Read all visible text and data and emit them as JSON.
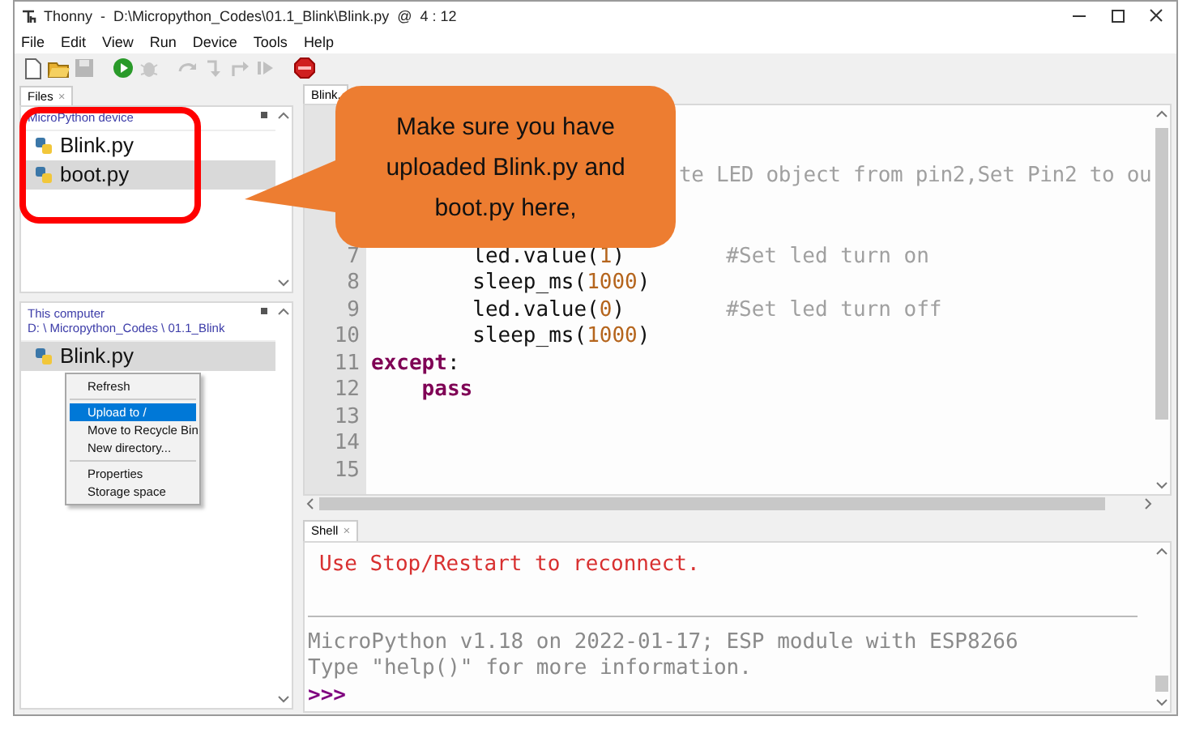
{
  "window": {
    "title": "Thonny  -  D:\\Micropython_Codes\\01.1_Blink\\Blink.py  @  4 : 12"
  },
  "menu": [
    "File",
    "Edit",
    "View",
    "Run",
    "Device",
    "Tools",
    "Help"
  ],
  "toolbar": [
    {
      "kind": "new",
      "disabled": false
    },
    {
      "kind": "open",
      "disabled": false
    },
    {
      "kind": "save",
      "disabled": true
    },
    {
      "kind": "run",
      "disabled": false
    },
    {
      "kind": "debug",
      "disabled": true
    },
    {
      "kind": "step-over",
      "disabled": true
    },
    {
      "kind": "step-into",
      "disabled": true
    },
    {
      "kind": "step-out",
      "disabled": true
    },
    {
      "kind": "resume",
      "disabled": true
    },
    {
      "kind": "stop",
      "disabled": false
    }
  ],
  "files_tab": {
    "label": "Files",
    "close": "×"
  },
  "device_panel": {
    "header": "MicroPython device",
    "files": [
      {
        "name": "Blink.py",
        "selected": false
      },
      {
        "name": "boot.py",
        "selected": true
      }
    ]
  },
  "computer_panel": {
    "header": "This computer",
    "path": "D: \\ Micropython_Codes \\ 01.1_Blink",
    "files": [
      {
        "name": "Blink.py",
        "selected": true
      }
    ]
  },
  "context_menu": [
    {
      "kind": "item",
      "label": "Refresh",
      "selected": false
    },
    {
      "kind": "separator"
    },
    {
      "kind": "item",
      "label": "Upload to /",
      "selected": true
    },
    {
      "kind": "item",
      "label": "Move to Recycle Bin",
      "selected": false
    },
    {
      "kind": "item",
      "label": "New directory...",
      "selected": false
    },
    {
      "kind": "separator"
    },
    {
      "kind": "item",
      "label": "Properties",
      "selected": false
    },
    {
      "kind": "item",
      "label": "Storage space",
      "selected": false
    }
  ],
  "editor": {
    "tab": "Blink.",
    "covered_line": {
      "tokens": [
        {
          "kind": "comment",
          "text": "te LED object from pin2,Set Pin2 to ou"
        }
      ]
    },
    "lines": [
      {
        "number": "7",
        "tokens": [
          {
            "kind": "plain",
            "text": "        led.value("
          },
          {
            "kind": "number",
            "text": "1"
          },
          {
            "kind": "plain",
            "text": ")        "
          },
          {
            "kind": "comment",
            "text": "#Set led turn on"
          }
        ]
      },
      {
        "number": "8",
        "tokens": [
          {
            "kind": "plain",
            "text": "        sleep_ms("
          },
          {
            "kind": "number",
            "text": "1000"
          },
          {
            "kind": "plain",
            "text": ")"
          }
        ]
      },
      {
        "number": "9",
        "tokens": [
          {
            "kind": "plain",
            "text": "        led.value("
          },
          {
            "kind": "number",
            "text": "0"
          },
          {
            "kind": "plain",
            "text": ")        "
          },
          {
            "kind": "comment",
            "text": "#Set led turn off"
          }
        ]
      },
      {
        "number": "10",
        "tokens": [
          {
            "kind": "plain",
            "text": "        sleep_ms("
          },
          {
            "kind": "number",
            "text": "1000"
          },
          {
            "kind": "plain",
            "text": ")"
          }
        ]
      },
      {
        "number": "11",
        "tokens": [
          {
            "kind": "keyword",
            "text": "except"
          },
          {
            "kind": "plain",
            "text": ":"
          }
        ]
      },
      {
        "number": "12",
        "tokens": [
          {
            "kind": "keyword",
            "text": "    pass"
          }
        ]
      },
      {
        "number": "13"
      },
      {
        "number": "14"
      },
      {
        "number": "15"
      }
    ]
  },
  "shell": {
    "tab": "Shell",
    "close": "×",
    "lines": [
      {
        "kind": "error",
        "text": "Use Stop/Restart to reconnect."
      },
      {
        "kind": "separator"
      },
      {
        "kind": "info",
        "text": "MicroPython v1.18 on 2022-01-17; ESP module with ESP8266"
      },
      {
        "kind": "info",
        "text": "Type \"help()\" for more information."
      },
      {
        "kind": "prompt",
        "text": ">>>"
      }
    ]
  },
  "callout": {
    "text": "Make sure you have uploaded Blink.py and boot.py here,"
  }
}
